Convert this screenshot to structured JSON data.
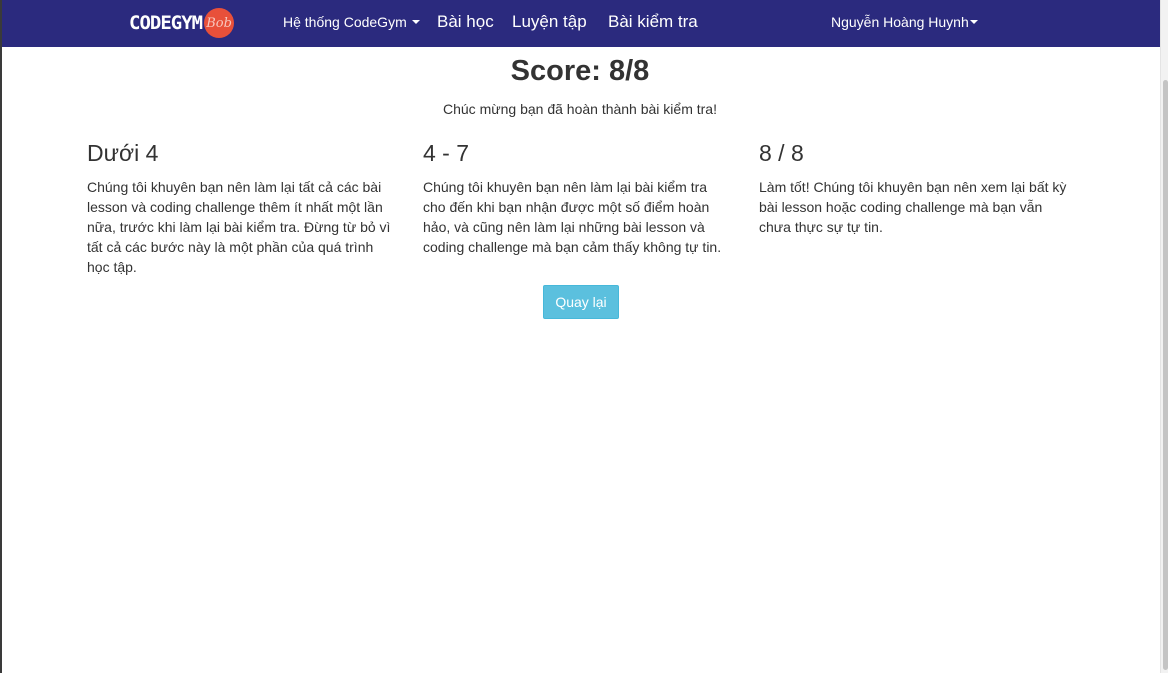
{
  "nav": {
    "logo": {
      "text": "CODEGYM",
      "badge": "Bob"
    },
    "items": [
      {
        "label": "Hệ thống CodeGym",
        "dropdown": true
      },
      {
        "label": "Bài học"
      },
      {
        "label": "Luyện tập"
      },
      {
        "label": "Bài kiểm tra"
      }
    ],
    "user": {
      "name": "Nguyễn Hoàng Huynh",
      "dropdown": true
    }
  },
  "result": {
    "score": "Score: 8/8",
    "message": "Chúc mừng bạn đã hoàn thành bài kiểm tra!"
  },
  "tiers": [
    {
      "range": "Dưới 4",
      "advice": "Chúng tôi khuyên bạn nên làm lại tất cả các bài lesson và coding challenge thêm ít nhất một lần nữa, trước khi làm lại bài kiểm tra. Đừng từ bỏ vì tất cả các bước này là một phần của quá trình học tập."
    },
    {
      "range": "4 - 7",
      "advice": "Chúng tôi khuyên bạn nên làm lại bài kiểm tra cho đến khi bạn nhận được một số điểm hoàn hảo, và cũng nên làm lại những bài lesson và coding challenge mà bạn cảm thấy không tự tin."
    },
    {
      "range": "8 / 8",
      "advice": "Làm tốt! Chúng tôi khuyên bạn nên xem lại bất kỳ bài lesson hoặc coding challenge mà bạn vẫn chưa thực sự tự tin."
    }
  ],
  "actions": {
    "back_label": "Quay lại"
  },
  "colors": {
    "navbar": "#2b2a7e",
    "logo_badge": "#e8503a",
    "button": "#5bc0de",
    "text": "#333333"
  }
}
